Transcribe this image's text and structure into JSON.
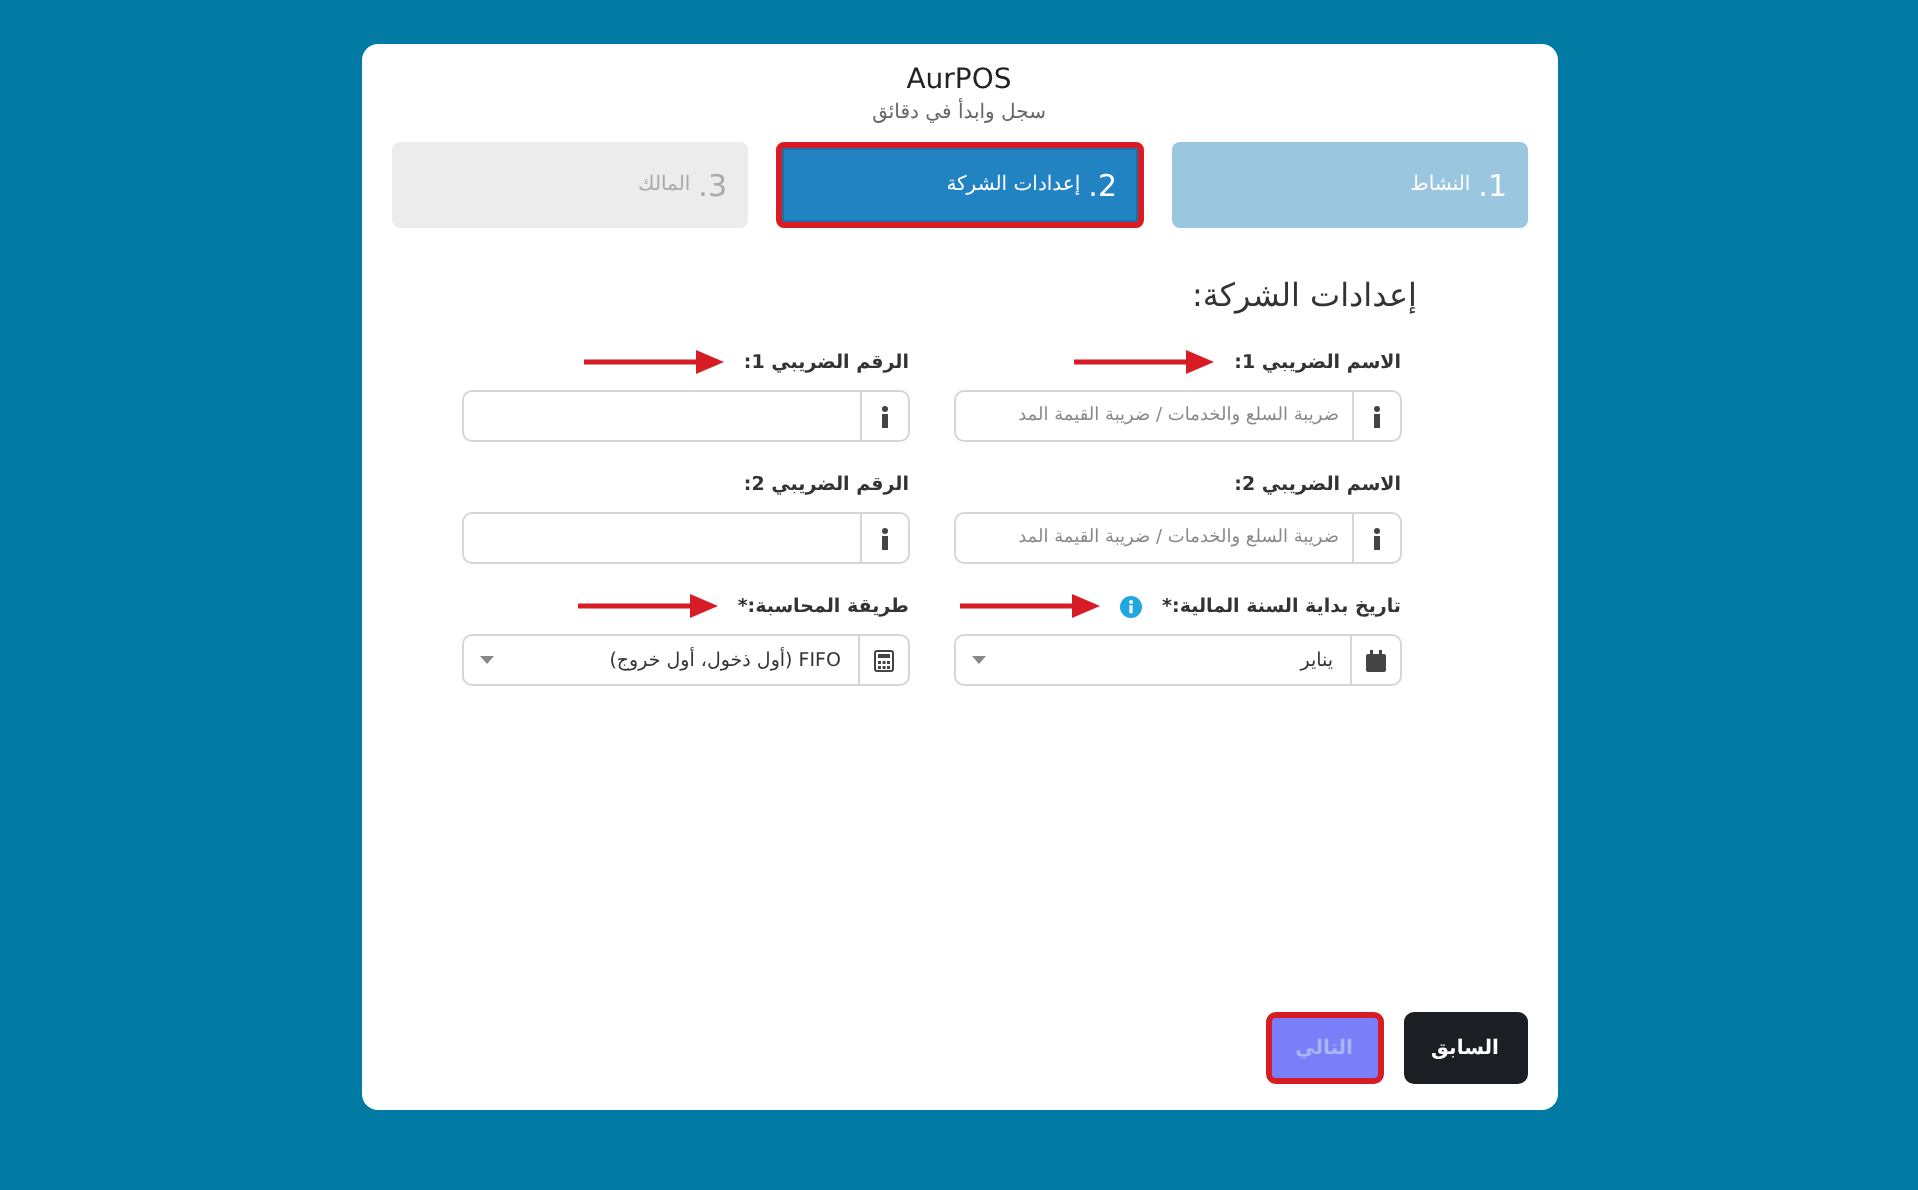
{
  "header": {
    "title": "AurPOS",
    "subtitle": "سجل وابدأ في دقائق"
  },
  "steps": [
    {
      "number": "1.",
      "label": "النشاط",
      "kind": "done",
      "selected": false,
      "highlighted": false
    },
    {
      "number": "2.",
      "label": "إعدادات الشركة",
      "kind": "current",
      "selected": true,
      "highlighted": true
    },
    {
      "number": "3.",
      "label": "المالك",
      "kind": "pending",
      "selected": false,
      "highlighted": false
    }
  ],
  "section_title": "إعدادات الشركة:",
  "fields": [
    {
      "label": "الاسم الضريبي 1:",
      "kind": "text",
      "placeholder": "ضريبة السلع والخدمات / ضريبة القيمة المد",
      "arrow": true,
      "info_badge": false
    },
    {
      "label": "الرقم الضريبي 1:",
      "kind": "text",
      "arrow": true,
      "info_badge": false
    },
    {
      "label": "الاسم الضريبي 2:",
      "kind": "text",
      "placeholder": "ضريبة السلع والخدمات / ضريبة القيمة المد",
      "arrow": false,
      "info_badge": false
    },
    {
      "label": "الرقم الضريبي 2:",
      "kind": "text",
      "arrow": false,
      "info_badge": false
    },
    {
      "label": "تاريخ بداية السنة المالية:*",
      "kind": "date-select",
      "value": "يناير",
      "arrow": true,
      "info_badge": true
    },
    {
      "label": "طريقة المحاسبة:*",
      "kind": "calc-select",
      "value": "FIFO (أول ذخول، أول خروج)",
      "arrow": true,
      "info_badge": false
    }
  ],
  "buttons": [
    {
      "label": "السابق",
      "kind": "previous",
      "highlighted": false
    },
    {
      "label": "التالي",
      "kind": "next",
      "highlighted": true
    }
  ]
}
